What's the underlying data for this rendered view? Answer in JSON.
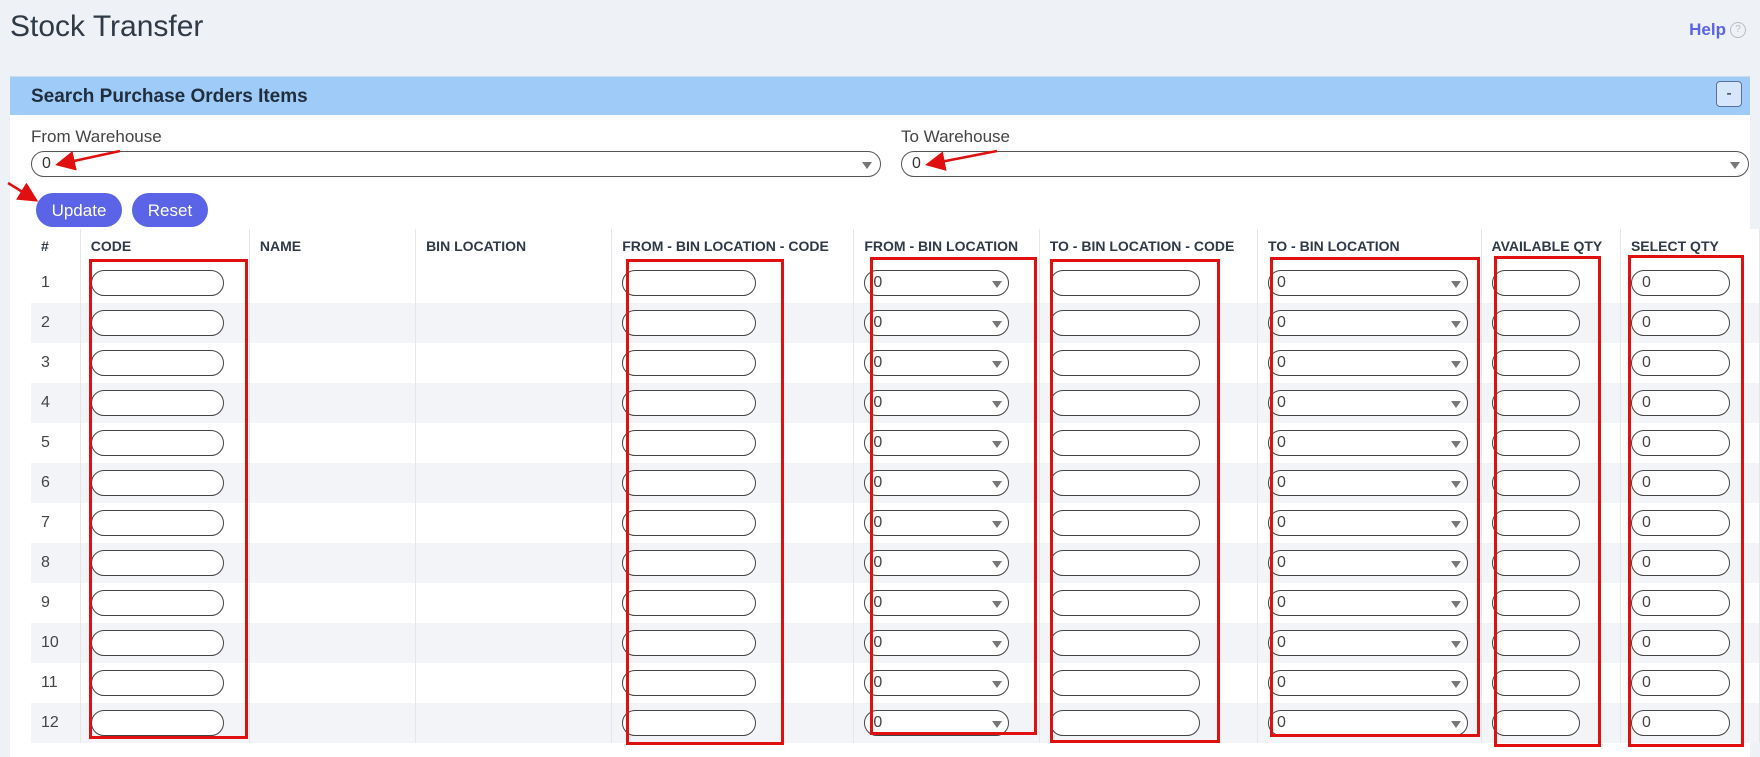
{
  "page": {
    "title": "Stock Transfer",
    "help_label": "Help",
    "help_icon": "?"
  },
  "panel": {
    "title": "Search Purchase Orders Items",
    "collapse_label": "-"
  },
  "filters": {
    "from_label": "From Warehouse",
    "from_value": "0",
    "to_label": "To Warehouse",
    "to_value": "0"
  },
  "actions": {
    "update_label": "Update",
    "reset_label": "Reset"
  },
  "table": {
    "columns": [
      "#",
      "CODE",
      "NAME",
      "BIN LOCATION",
      "FROM - BIN LOCATION - CODE",
      "FROM - BIN LOCATION",
      "TO - BIN LOCATION - CODE",
      "TO - BIN LOCATION",
      "AVAILABLE QTY",
      "SELECT QTY"
    ],
    "rows": [
      {
        "num": "1",
        "from_bin": "0",
        "to_bin": "0",
        "select_qty": "0"
      },
      {
        "num": "2",
        "from_bin": "0",
        "to_bin": "0",
        "select_qty": "0"
      },
      {
        "num": "3",
        "from_bin": "0",
        "to_bin": "0",
        "select_qty": "0"
      },
      {
        "num": "4",
        "from_bin": "0",
        "to_bin": "0",
        "select_qty": "0"
      },
      {
        "num": "5",
        "from_bin": "0",
        "to_bin": "0",
        "select_qty": "0"
      },
      {
        "num": "6",
        "from_bin": "0",
        "to_bin": "0",
        "select_qty": "0"
      },
      {
        "num": "7",
        "from_bin": "0",
        "to_bin": "0",
        "select_qty": "0"
      },
      {
        "num": "8",
        "from_bin": "0",
        "to_bin": "0",
        "select_qty": "0"
      },
      {
        "num": "9",
        "from_bin": "0",
        "to_bin": "0",
        "select_qty": "0"
      },
      {
        "num": "10",
        "from_bin": "0",
        "to_bin": "0",
        "select_qty": "0"
      },
      {
        "num": "11",
        "from_bin": "0",
        "to_bin": "0",
        "select_qty": "0"
      },
      {
        "num": "12",
        "from_bin": "0",
        "to_bin": "0",
        "select_qty": "0"
      }
    ]
  },
  "colors": {
    "accent": "#5b63e6",
    "panel_header": "#9fcbf8",
    "annotation": "#e01010"
  }
}
